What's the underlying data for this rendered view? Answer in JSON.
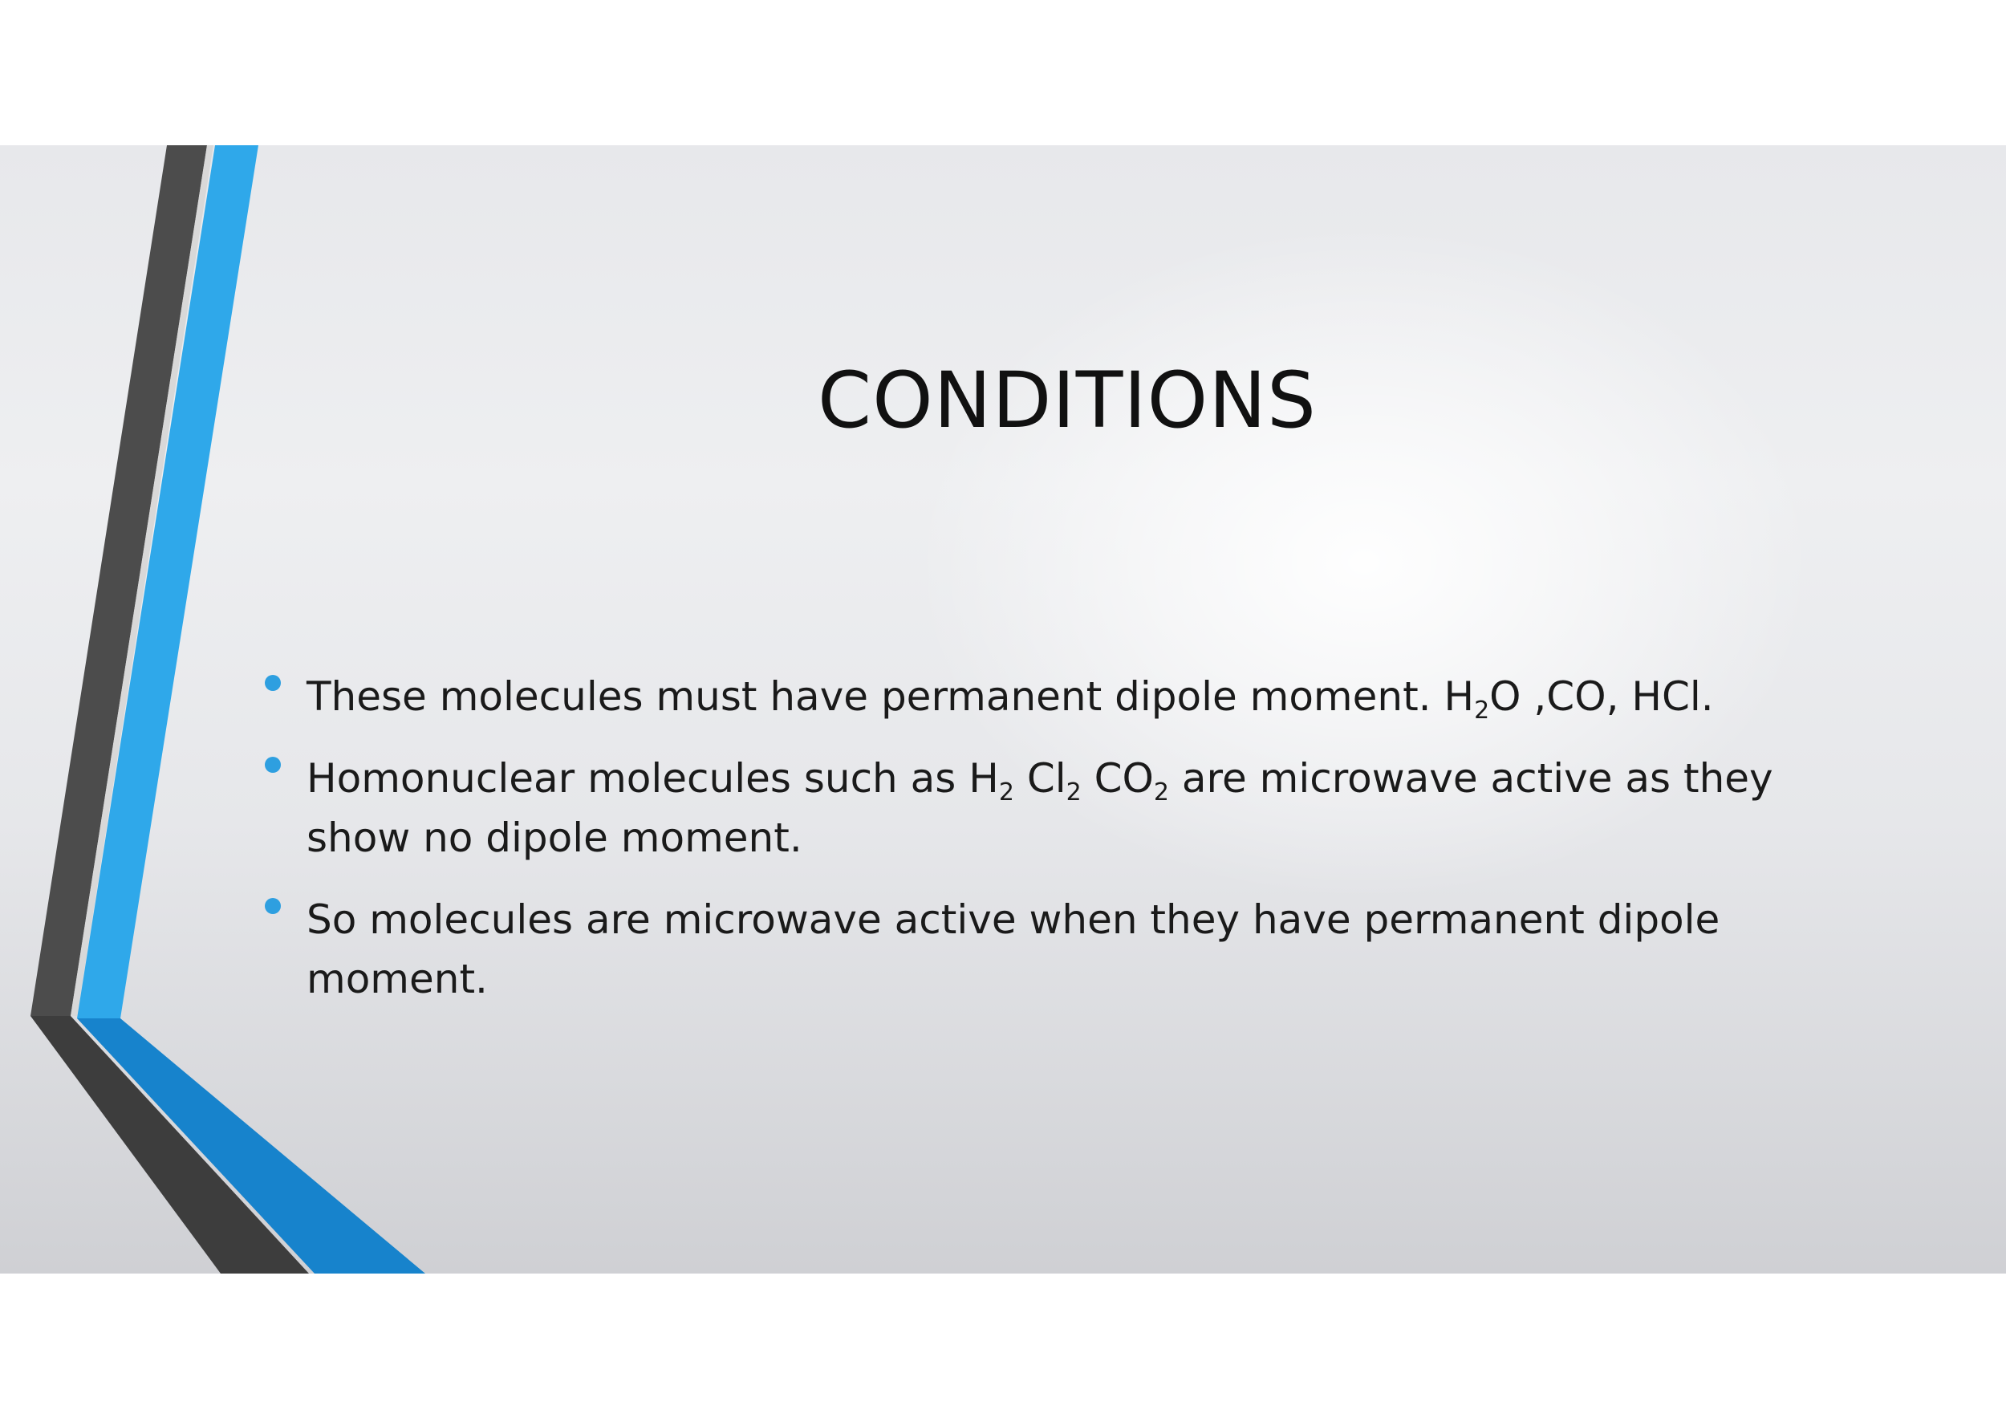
{
  "slide": {
    "title": "CONDITIONS",
    "bullets": [
      {
        "parts": [
          {
            "text": "These molecules must have permanent dipole moment. H"
          },
          {
            "text": "2",
            "sub": true
          },
          {
            "text": "O ,CO, HCl."
          }
        ]
      },
      {
        "parts": [
          {
            "text": "Homonuclear molecules such as H"
          },
          {
            "text": "2",
            "sub": true
          },
          {
            "text": " Cl"
          },
          {
            "text": "2",
            "sub": true
          },
          {
            "text": " CO"
          },
          {
            "text": "2",
            "sub": true
          },
          {
            "text": " are microwave active as they show no dipole moment."
          }
        ]
      },
      {
        "parts": [
          {
            "text": "So molecules are microwave active when they have permanent dipole moment."
          }
        ]
      }
    ]
  },
  "colors": {
    "accent_blue": "#2ea7ea",
    "dark_stripe": "#474747",
    "bullet_dot": "#2e9fe0"
  }
}
